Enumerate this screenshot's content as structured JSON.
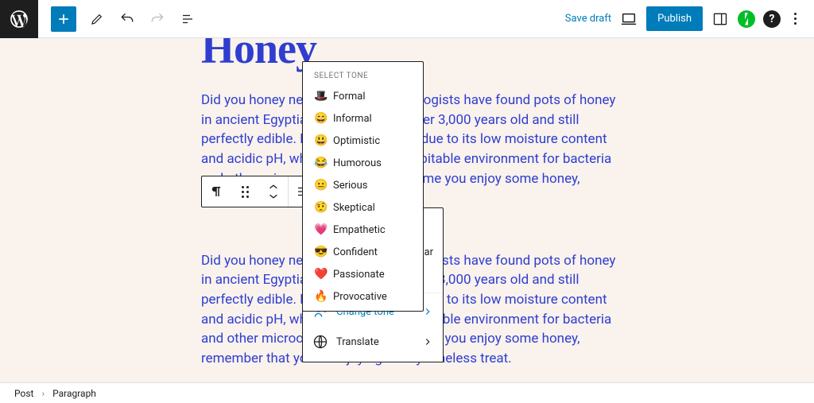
{
  "topbar": {
    "save_draft": "Save draft",
    "publish": "Publish"
  },
  "post": {
    "title": "Honey",
    "para1_a": "Did you honey never spoils? Archaeologists have found pots of honey in ancient Egyptian tombs that are over 3,000 years old and still perfectly edible. Honey's longevity is due to its low moisture content and acidic pH, which create an inhospitable environment for bacteria and other ",
    "para1_link": "microorganisms",
    "para1_b": ". So next time you enjoy some honey, remember that you're",
    "para2": "Did you honey never spoils? Archaeologists have found pots of honey in ancient Egyptian tombs that are over 3,000 years old and still perfectly edible. Honey's longevity is due to its low moisture content and acidic pH, which create an inhospitable environment for bacteria and other microorganisms. So next time you enjoy some honey, remember that you're enjoying a truly timeless treat."
  },
  "tone": {
    "header": "Select Tone",
    "items": [
      {
        "emoji": "🎩",
        "label": "Formal"
      },
      {
        "emoji": "😄",
        "label": "Informal"
      },
      {
        "emoji": "😃",
        "label": "Optimistic"
      },
      {
        "emoji": "😂",
        "label": "Humorous"
      },
      {
        "emoji": "😐",
        "label": "Serious"
      },
      {
        "emoji": "🤨",
        "label": "Skeptical"
      },
      {
        "emoji": "💗",
        "label": "Empathetic"
      },
      {
        "emoji": "😎",
        "label": "Confident"
      },
      {
        "emoji": "❤️",
        "label": "Passionate"
      },
      {
        "emoji": "🔥",
        "label": "Provocative"
      }
    ]
  },
  "ai": {
    "grammar_tail": "nar",
    "change_tone": "Change tone",
    "translate": "Translate"
  },
  "crumbs": {
    "a": "Post",
    "b": "Paragraph"
  }
}
